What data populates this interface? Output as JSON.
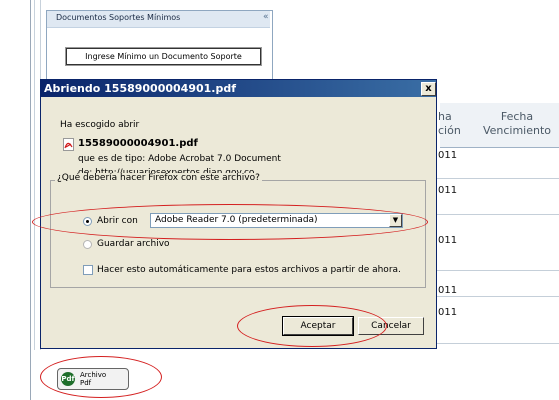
{
  "background": {
    "panel_title": "Documentos Soportes Mínimos",
    "panel_collapse": "«",
    "support_button": "Ingrese Mínimo un Documento Soporte",
    "col_issue_partial": "ha\nción",
    "col_due": "Fecha\nVencimiento",
    "row_fragments": [
      "011",
      "011",
      "011",
      "011",
      "011"
    ]
  },
  "dialog": {
    "title": "Abriendo 15589000004901.pdf",
    "close": "x",
    "chosen_label": "Ha escogido abrir",
    "file_name": "15589000004901.pdf",
    "type_line": "que es de tipo:  Adobe Acrobat 7.0 Document",
    "from_line": "de:  http://usuariosexpertos.dian.gov.co",
    "question": "¿Qué debería hacer Firefox con este archivo?",
    "open_with_label": "Abrir con",
    "open_with_value": "Adobe Reader 7.0 (predeterminada)",
    "save_label": "Guardar archivo",
    "auto_label": "Hacer esto automáticamente para estos archivos a partir de ahora.",
    "accept_label": "Aceptar",
    "cancel_label": "Cancelar"
  },
  "bottom_button": {
    "icon_text": "Pdf",
    "line1": "Archivo",
    "line2": "Pdf"
  },
  "colors": {
    "title_bar_start": "#0a246a",
    "title_bar_end": "#3a6ea5",
    "dialog_bg": "#ece9d8",
    "annotation": "#d42020"
  }
}
